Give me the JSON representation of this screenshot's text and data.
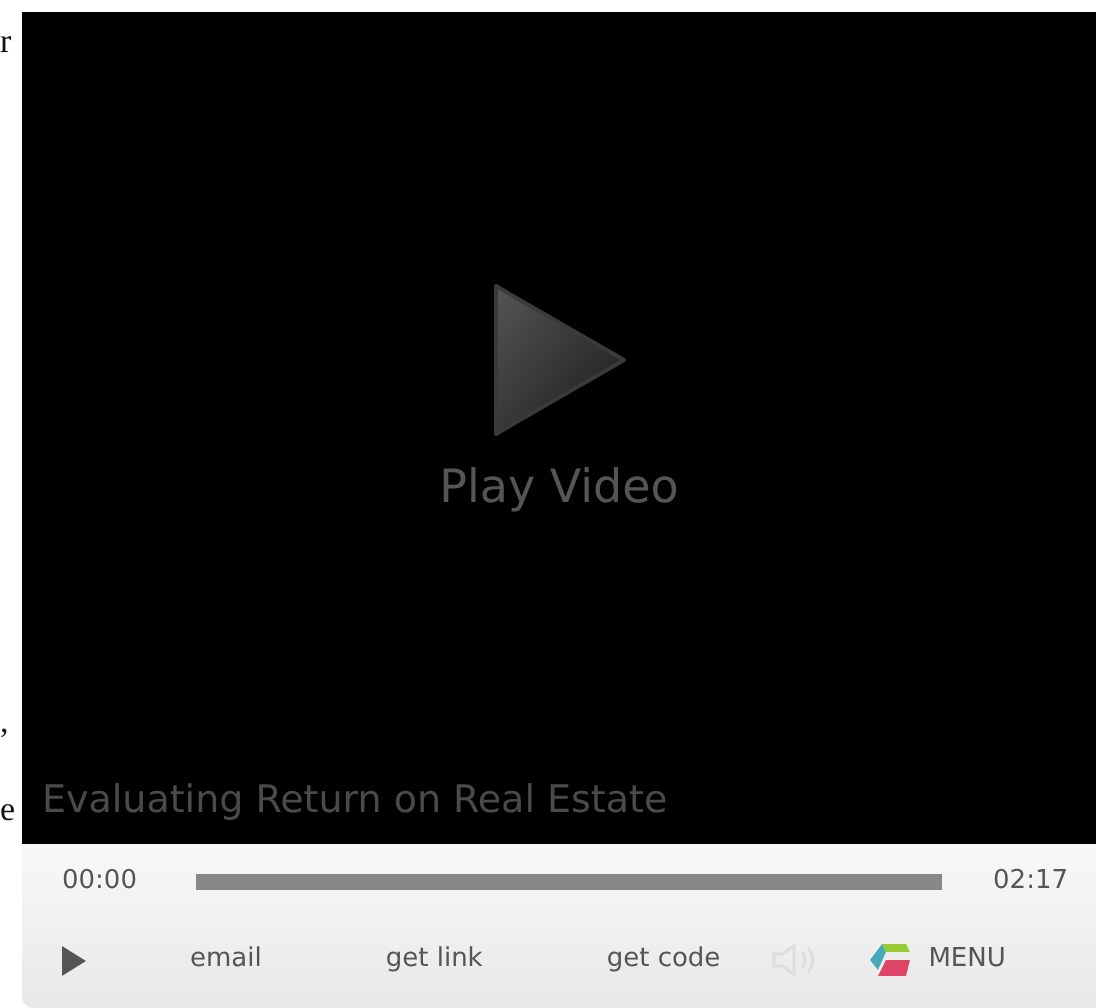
{
  "page_fragments": [
    "r",
    ",",
    "e"
  ],
  "player": {
    "overlay_label": "Play Video",
    "video_title": "Evaluating Return on Real Estate",
    "controls": {
      "elapsed": "00:00",
      "duration": "02:17",
      "progress": {
        "level": 0
      },
      "links": [
        "email",
        "get link",
        "get code"
      ],
      "menu": "MENU"
    }
  }
}
